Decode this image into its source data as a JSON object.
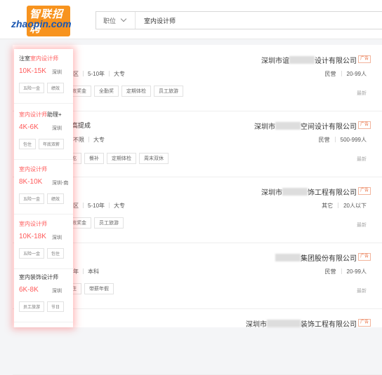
{
  "logo": {
    "top_text": "智联招聘",
    "bottom_text": "zhaopin.com"
  },
  "search": {
    "category": "职位",
    "query": "室内设计师"
  },
  "jobs": [
    {
      "company_pre": "深圳市谊",
      "company_post": "设计有限公司",
      "ad": "广告",
      "company_type": "民营",
      "company_size": "20-99人",
      "requirements": [
        "龙岗区",
        "5-10年",
        "大专"
      ],
      "tags": [
        "绩效奖金",
        "全勤奖",
        "定期体检",
        "员工旅游"
      ],
      "updated": "最新"
    },
    {
      "title_tail": "高提成",
      "company_pre": "深圳市",
      "company_post": "空间设计有限公司",
      "ad": "广告",
      "company_type": "民营",
      "company_size": "500-999人",
      "requirements": [
        "经验不限",
        "大专"
      ],
      "tags": [
        "包吃",
        "餐补",
        "定期体检",
        "周末双休"
      ],
      "updated": "最新"
    },
    {
      "company_pre": "深圳市",
      "company_post": "饰工程有限公司",
      "ad": "广告",
      "company_type": "其它",
      "company_size": "20人以下",
      "requirements": [
        "南山区",
        "5-10年",
        "大专"
      ],
      "tags": [
        "绩效奖金",
        "员工旅游"
      ],
      "updated": "最新"
    },
    {
      "company_pre": "",
      "company_post": "集团股份有限公司",
      "ad": "广告",
      "company_type": "民营",
      "company_size": "20-99人",
      "requirements": [
        "5-10年",
        "本科"
      ],
      "tags": [
        "包住",
        "带薪年假"
      ],
      "updated": "最新"
    },
    {
      "company_pre": "深圳市",
      "company_post": "装饰工程有限公司",
      "ad": "广告",
      "company_type": "",
      "company_size": "",
      "requirements": [],
      "tags": [],
      "updated": ""
    }
  ],
  "overlay": [
    {
      "title_pre": "注室",
      "title_hl": "室内设计师",
      "title_post": "",
      "salary": "10K-15K",
      "location": "深圳",
      "tags": [
        "五险一金",
        "绩效"
      ]
    },
    {
      "title_pre": "",
      "title_hl": "室内设计师",
      "title_post": "助理+",
      "salary": "4K-6K",
      "location": "深圳",
      "tags": [
        "包住",
        "年底双薪"
      ]
    },
    {
      "title_pre": "",
      "title_hl": "室内设计师",
      "title_post": "",
      "salary": "8K-10K",
      "location": "深圳-南",
      "tags": [
        "五险一金",
        "绩效"
      ]
    },
    {
      "title_pre": "",
      "title_hl": "室内设计师",
      "title_post": "",
      "salary": "10K-18K",
      "location": "深圳",
      "tags": [
        "五险一金",
        "包住"
      ]
    },
    {
      "title_pre": "室内装饰设计师",
      "title_hl": "",
      "title_post": "",
      "salary": "6K-8K",
      "location": "深圳",
      "tags": [
        "员工旅游",
        "节日"
      ]
    }
  ]
}
